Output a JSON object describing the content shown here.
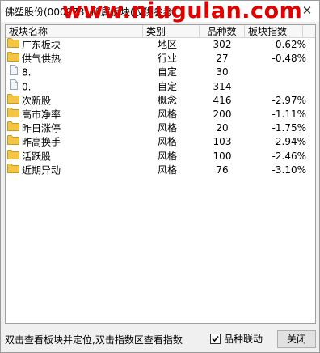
{
  "window": {
    "title": "佛塑股份(000973) 所属板块(仅供参考)",
    "watermark": "www.niugulan.com",
    "close_glyph": "✕"
  },
  "table": {
    "columns": [
      "板块名称",
      "类别",
      "品种数",
      "板块指数"
    ],
    "rows": [
      {
        "icon": "folder-icon",
        "name": "广东板块",
        "type": "地区",
        "count": "302",
        "index": "-0.62%"
      },
      {
        "icon": "folder-icon",
        "name": "供气供热",
        "type": "行业",
        "count": "27",
        "index": "-0.48%"
      },
      {
        "icon": "document-icon",
        "name": "8.",
        "type": "自定",
        "count": "30",
        "index": ""
      },
      {
        "icon": "document-icon",
        "name": "0.",
        "type": "自定",
        "count": "314",
        "index": ""
      },
      {
        "icon": "folder-icon",
        "name": "次新股",
        "type": "概念",
        "count": "416",
        "index": "-2.97%"
      },
      {
        "icon": "folder-icon",
        "name": "高市净率",
        "type": "风格",
        "count": "200",
        "index": "-1.11%"
      },
      {
        "icon": "folder-icon",
        "name": "昨日涨停",
        "type": "风格",
        "count": "20",
        "index": "-1.75%"
      },
      {
        "icon": "folder-icon",
        "name": "昨高换手",
        "type": "风格",
        "count": "103",
        "index": "-2.94%"
      },
      {
        "icon": "folder-icon",
        "name": "活跃股",
        "type": "风格",
        "count": "100",
        "index": "-2.46%"
      },
      {
        "icon": "folder-icon",
        "name": "近期异动",
        "type": "风格",
        "count": "76",
        "index": "-3.10%"
      }
    ]
  },
  "footer": {
    "hint": "双击查看板块并定位,双击指数区查看指数",
    "checkbox_label": "品种联动",
    "checkbox_checked": true,
    "close_button": "关闭"
  },
  "colors": {
    "folder": "#f4c542",
    "folder_border": "#c99a1e",
    "watermark": "#e00000"
  }
}
